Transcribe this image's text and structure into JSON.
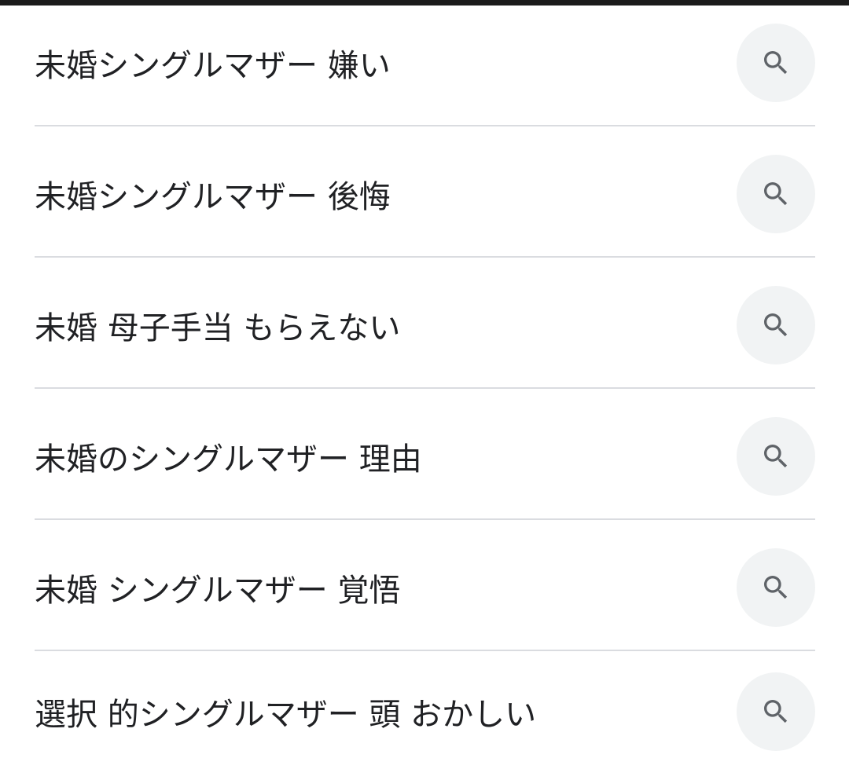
{
  "suggestions": [
    {
      "text": "未婚シングルマザー 嫌い",
      "icon": "search-icon"
    },
    {
      "text": "未婚シングルマザー 後悔",
      "icon": "search-icon"
    },
    {
      "text": "未婚 母子手当 もらえない",
      "icon": "search-icon"
    },
    {
      "text": "未婚のシングルマザー 理由",
      "icon": "search-icon"
    },
    {
      "text": "未婚 シングルマザー 覚悟",
      "icon": "search-icon"
    },
    {
      "text": "選択 的シングルマザー 頭 おかしい",
      "icon": "search-icon"
    }
  ],
  "colors": {
    "text": "#202124",
    "icon": "#5f6368",
    "button_bg": "#f1f3f4",
    "divider": "#dadce0"
  }
}
